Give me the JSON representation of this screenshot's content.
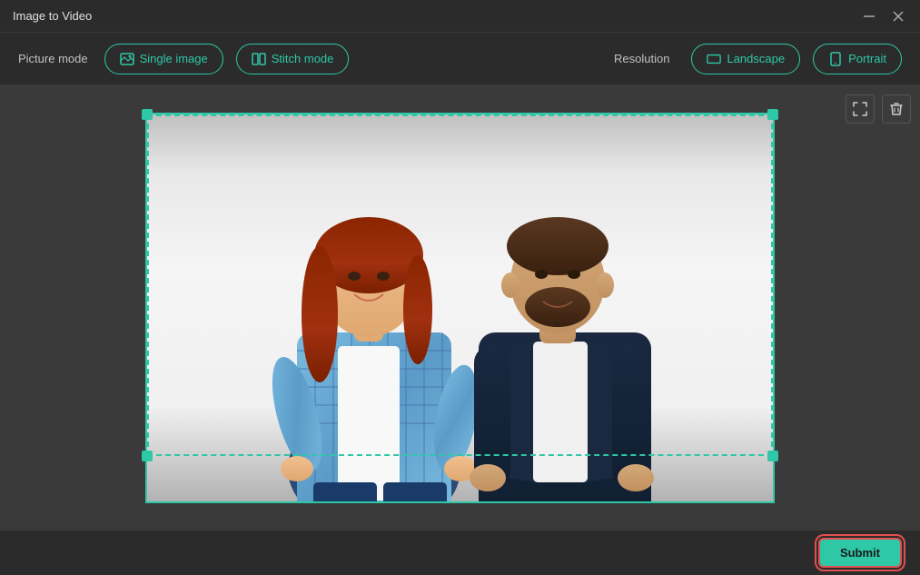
{
  "window": {
    "title": "Image to Video",
    "minimize_label": "minimize",
    "close_label": "close"
  },
  "toolbar": {
    "picture_mode_label": "Picture mode",
    "single_image_label": "Single image",
    "stitch_mode_label": "Stitch mode",
    "resolution_label": "Resolution",
    "landscape_label": "Landscape",
    "portrait_label": "Portrait"
  },
  "canvas": {
    "expand_tooltip": "expand",
    "delete_tooltip": "delete"
  },
  "bottom": {
    "submit_label": "Submit"
  },
  "icons": {
    "single_image": "🖼",
    "stitch_mode": "🖼",
    "landscape": "🖥",
    "portrait": "📱",
    "expand": "⛶",
    "delete": "🗑"
  }
}
